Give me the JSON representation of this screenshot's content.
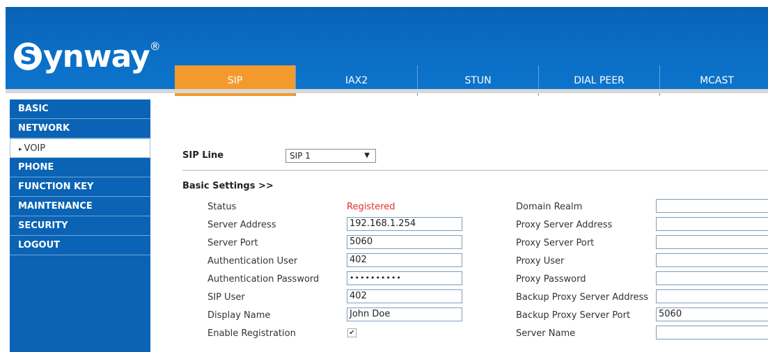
{
  "brand": {
    "name": "Synway",
    "initial": "S",
    "reg": "®"
  },
  "tabs": [
    "SIP",
    "IAX2",
    "STUN",
    "DIAL PEER",
    "MCAST"
  ],
  "sidebar": [
    {
      "label": "BASIC"
    },
    {
      "label": "NETWORK"
    },
    {
      "label": "VOIP",
      "arrow": "▸"
    },
    {
      "label": "PHONE"
    },
    {
      "label": "FUNCTION KEY"
    },
    {
      "label": "MAINTENANCE"
    },
    {
      "label": "SECURITY"
    },
    {
      "label": "LOGOUT"
    }
  ],
  "sip_line": {
    "label": "SIP Line",
    "selected": "SIP 1",
    "caret": "▼"
  },
  "basic_settings": {
    "title": "Basic Settings >>"
  },
  "left_fields": [
    {
      "label": "Status",
      "value": "Registered",
      "type": "status"
    },
    {
      "label": "Server Address",
      "value": "192.168.1.254",
      "type": "input"
    },
    {
      "label": "Server Port",
      "value": "5060",
      "type": "input"
    },
    {
      "label": "Authentication User",
      "value": "402",
      "type": "input"
    },
    {
      "label": "Authentication Password",
      "value": "••••••••••",
      "type": "input"
    },
    {
      "label": "SIP User",
      "value": "402",
      "type": "input"
    },
    {
      "label": "Display Name",
      "value": "John Doe",
      "type": "input"
    },
    {
      "label": "Enable Registration",
      "value": "✔",
      "type": "checkbox",
      "checked": true
    }
  ],
  "right_fields": [
    {
      "label": "Domain Realm",
      "value": ""
    },
    {
      "label": "Proxy Server Address",
      "value": ""
    },
    {
      "label": "Proxy Server Port",
      "value": ""
    },
    {
      "label": "Proxy User",
      "value": ""
    },
    {
      "label": "Proxy Password",
      "value": ""
    },
    {
      "label": "Backup Proxy Server Address",
      "value": ""
    },
    {
      "label": "Backup Proxy Server Port",
      "value": "5060"
    },
    {
      "label": "Server Name",
      "value": ""
    }
  ],
  "colors": {
    "header": "#0b6fc6",
    "active_tab": "#f49a2c",
    "sidebar": "#0a63b4",
    "status_text": "#e03030"
  }
}
